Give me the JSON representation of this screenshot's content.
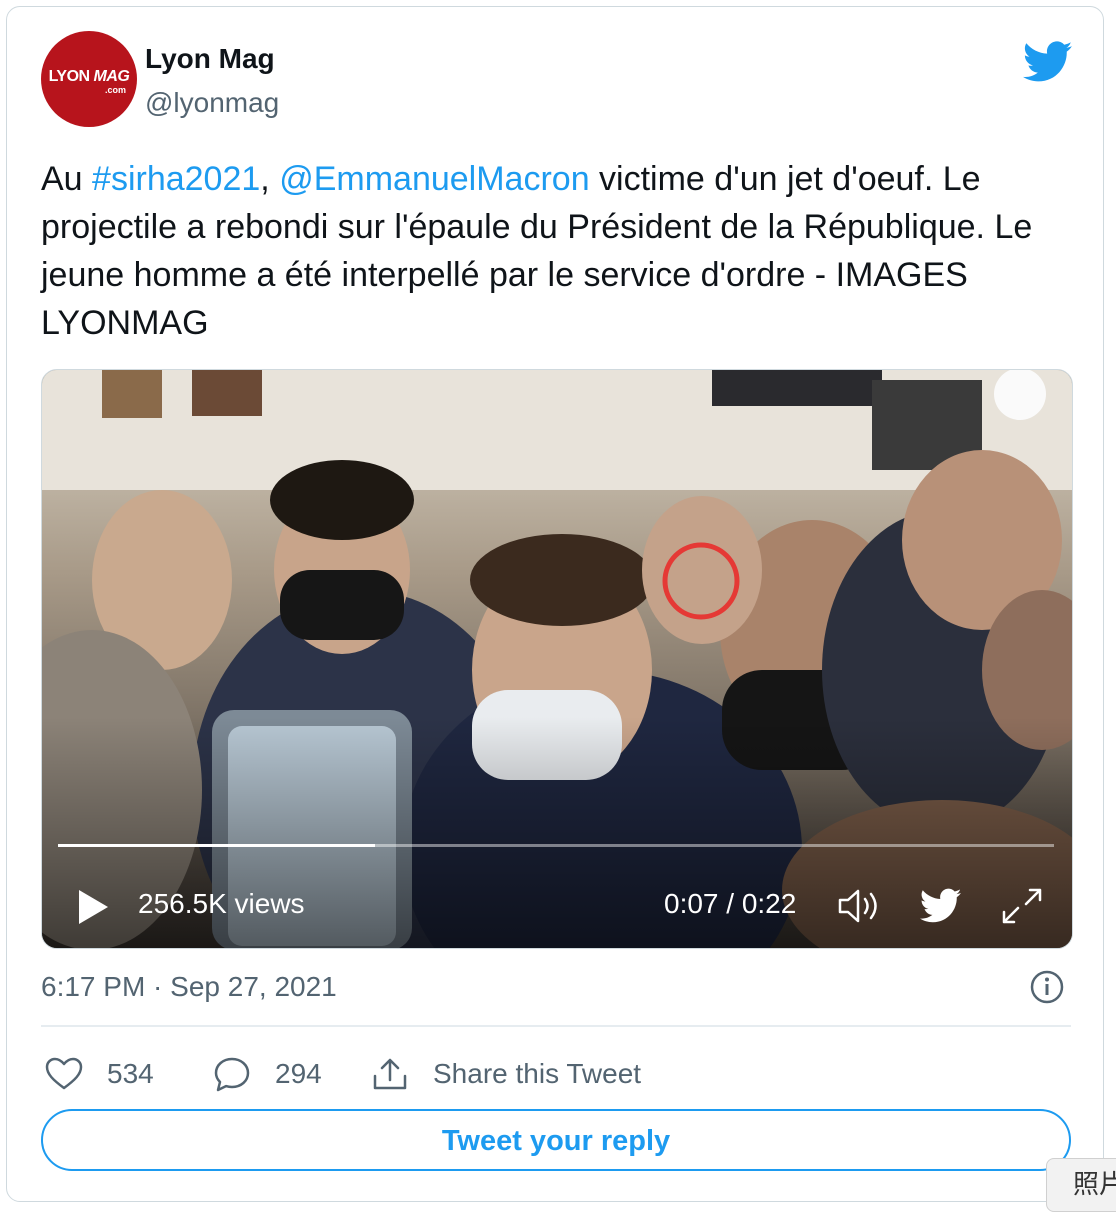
{
  "author": {
    "display_name": "Lyon Mag",
    "handle": "@lyonmag",
    "avatar_text": "LYON MAG",
    "avatar_subtext": ".com",
    "avatar_color": "#b7141c"
  },
  "tweet": {
    "text_part1": "Au ",
    "hashtag": "#sirha2021",
    "text_part2": ", ",
    "mention": "@EmmanuelMacron",
    "text_part3": " victime d'un jet d'oeuf. Le projectile a rebondi sur l'épaule du Président de la République. Le jeune homme a été interpellé par le service d'ordre - IMAGES LYONMAG",
    "link_color": "#1d9bf0"
  },
  "video": {
    "views": "256.5K views",
    "time": "0:07 / 0:22",
    "progress": 0.318,
    "icons": [
      "play-icon",
      "volume-icon",
      "twitter-bird-icon",
      "fullscreen-icon"
    ]
  },
  "timestamp": "6:17 PM · Sep 27, 2021",
  "actions": {
    "likes": "534",
    "replies": "294",
    "share_label": "Share this Tweet"
  },
  "reply_button": "Tweet your reply",
  "overlay_chip": "照片",
  "brand_color": "#1d9bf0"
}
